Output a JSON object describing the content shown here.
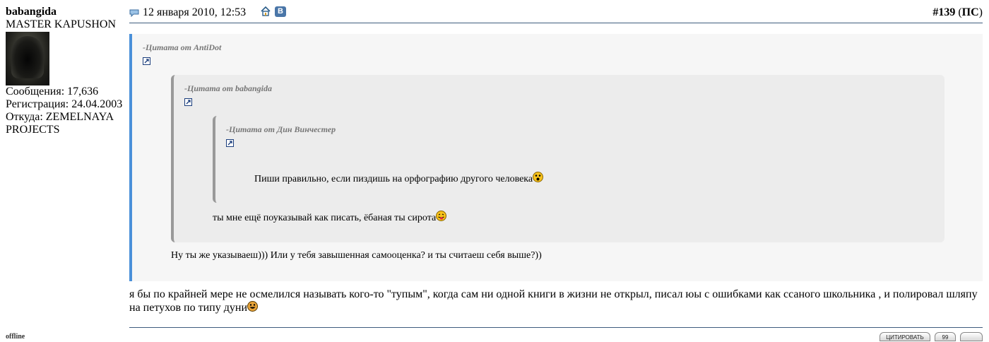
{
  "user": {
    "name": "babangida",
    "rank": "MASTER KAPUSHON",
    "posts_line": "Сообщения: 17,636",
    "reg_line": "Регистрация: 24.04.2003",
    "from_line1": "Откуда: ZEMELNAYA",
    "from_line2": "PROJECTS",
    "status": "offline"
  },
  "post": {
    "date": "12 января 2010, 12:53",
    "number": "#139",
    "ps_open": " (",
    "ps_label": "ПС",
    "ps_close": ")"
  },
  "quotes": {
    "q1_head": "-Цитата от AntiDot",
    "q2_head": "-Цитата от babangida",
    "q3_head": "-Цитата от Дин Винчестер",
    "q3_text": "Пиши правильно, если пиздишь на орфографию другого человека",
    "q2_text": "ты мне ещё поуказывай как писать, ёбаная ты сирота",
    "q1_text": "Ну ты же указываеш))) Или у тебя завышенная самооценка? и ты считаеш себя выше?))"
  },
  "message": "я бы по крайней мере не осмелился называть кого-то \"тупым\", когда сам ни одной книги в жизни не открыл, писал юы с ошибками как ссаного школьника , и полировал шляпу на петухов по типу дуни",
  "buttons": {
    "quote": "ЦИТИРОВАТЬ",
    "multiquote": "99",
    "report": ""
  },
  "icons": {
    "post": "post-icon",
    "home": "home-icon",
    "vk": "vk-icon",
    "vk_letter": "В",
    "link": "external-link-icon",
    "accent": "#4a90d9",
    "rule": "#3e5c7e"
  }
}
